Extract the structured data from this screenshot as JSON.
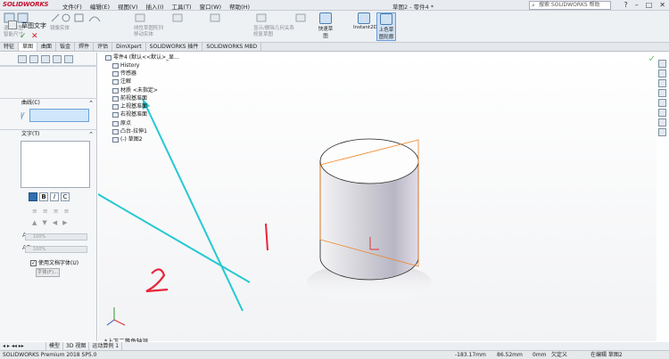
{
  "app": {
    "logo": "SOLIDWORKS",
    "doc_title": "草图2 - 零件4 *",
    "search_placeholder": "搜索 SOLIDWORKS 帮助"
  },
  "menu": [
    "文件(F)",
    "编辑(E)",
    "视图(V)",
    "插入(I)",
    "工具(T)",
    "窗口(W)",
    "帮助(H)"
  ],
  "ribbon": {
    "groups": [
      "退出草图",
      "智能尺寸",
      "镜像实体",
      "线性草图阵列",
      "移动实体",
      "显示/删除几何关系",
      "修复草图"
    ],
    "buttons": [
      "快速草图",
      "Instant2D",
      "上色草图轮廓"
    ]
  },
  "tabs": [
    "特征",
    "草图",
    "曲面",
    "钣金",
    "焊件",
    "评估",
    "DimXpert",
    "SOLIDWORKS 插件",
    "SOLIDWORKS MBD"
  ],
  "active_tab": "草图",
  "panel": {
    "title": "草图文字",
    "section_curve": "曲线(C)",
    "section_text": "文字(T)",
    "pct1": "100%",
    "pct2": "100%",
    "checkbox_label": "使用文档字体(U)",
    "font_button": "字体(F)..."
  },
  "tree": {
    "root": "零件4 (默认<<默认>_显...",
    "items": [
      "History",
      "传感器",
      "注解",
      "材质 <未指定>",
      "前视基准面",
      "上视基准面",
      "右视基准面",
      "原点",
      "凸台-拉伸1",
      "(-) 草图2"
    ]
  },
  "annotations": {
    "one": "1",
    "two": "2"
  },
  "view_label": "*上下二等角轴测",
  "bottom_tabs": [
    "模型",
    "3D 视图",
    "运动算例 1"
  ],
  "status": {
    "app_version": "SOLIDWORKS Premium 2018 SP5.0",
    "x": "-183.17mm",
    "y": "86.52mm",
    "z": "0mm",
    "state": "欠定义",
    "mode": "在编辑 草图2"
  },
  "colors": {
    "accent_annotation": "#e8253a",
    "arrow": "#25c9d2",
    "sketch_orange": "#f0821e"
  }
}
